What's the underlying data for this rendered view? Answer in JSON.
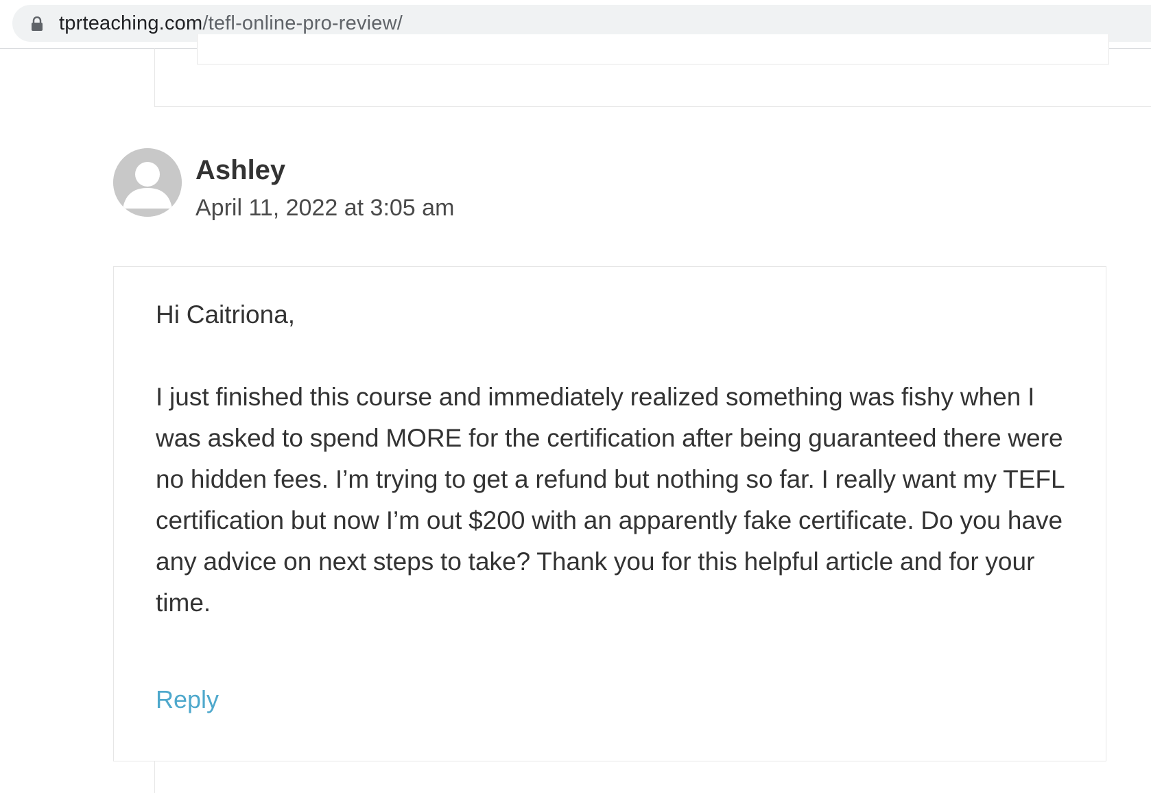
{
  "browser": {
    "url_domain": "tprteaching.com",
    "url_path": "/tefl-online-pro-review/",
    "lock_icon": "lock-icon"
  },
  "comment": {
    "author": "Ashley",
    "date": "April 11, 2022 at 3:05 am",
    "avatar_icon": "default-user-avatar-icon",
    "paragraphs": [
      "Hi Caitriona,",
      "I just finished this course and immediately realized something was fishy when I was asked to spend MORE for the certification after being guaranteed there were no hidden fees. I’m trying to get a refund but nothing so far. I really want my TEFL certification but now I’m out $200 with an apparently fake certificate. Do you have any advice on next steps to take? Thank you for this helpful article and for your time."
    ],
    "reply_label": "Reply"
  },
  "colors": {
    "link": "#4ea8cc",
    "text": "#333333",
    "border": "#e6e6e6",
    "avatar": "#c8c8c8"
  }
}
